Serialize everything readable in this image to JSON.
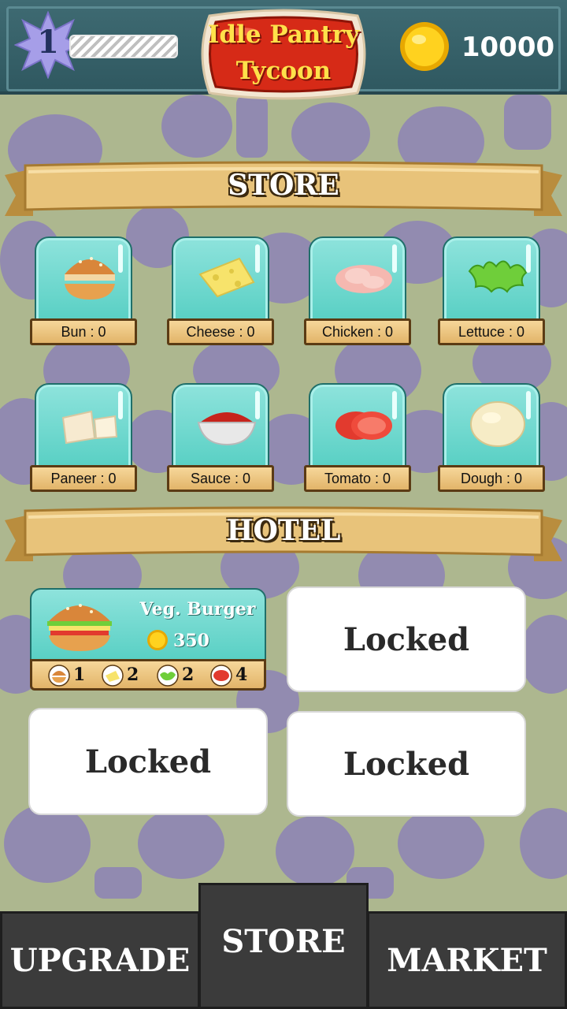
{
  "header": {
    "level": "1",
    "xp_progress": 0,
    "title_line1": "Idle Pantry",
    "title_line2": "Tycoon",
    "coins": "10000"
  },
  "store": {
    "heading": "STORE",
    "items": [
      {
        "label": "Bun : 0",
        "icon": "bun-icon"
      },
      {
        "label": "Cheese : 0",
        "icon": "cheese-icon"
      },
      {
        "label": "Chicken : 0",
        "icon": "chicken-icon"
      },
      {
        "label": "Lettuce : 0",
        "icon": "lettuce-icon"
      },
      {
        "label": "Paneer : 0",
        "icon": "paneer-icon"
      },
      {
        "label": "Sauce : 0",
        "icon": "sauce-icon"
      },
      {
        "label": "Tomato : 0",
        "icon": "tomato-icon"
      },
      {
        "label": "Dough : 0",
        "icon": "dough-icon"
      }
    ]
  },
  "hotel": {
    "heading": "HOTEL",
    "recipe": {
      "name": "Veg. Burger",
      "price": "350",
      "ingredients": [
        {
          "icon": "bun-icon",
          "count": "1"
        },
        {
          "icon": "cheese-icon",
          "count": "2"
        },
        {
          "icon": "lettuce-icon",
          "count": "2"
        },
        {
          "icon": "tomato-icon",
          "count": "4"
        }
      ]
    },
    "locked_label": "Locked"
  },
  "nav": {
    "upgrade": "UPGRADE",
    "store": "STORE",
    "market": "MARKET"
  },
  "colors": {
    "background": "#adb78f",
    "pattern": "#8f86b4",
    "header": "#3f6b73",
    "tile": "#57cfc3",
    "label": "#e2b469",
    "nav": "#3b3b3b"
  }
}
